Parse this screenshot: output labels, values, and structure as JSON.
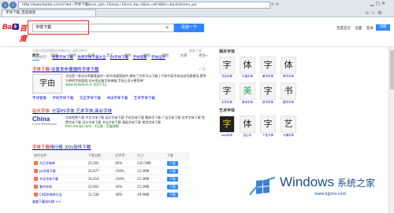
{
  "browser": {
    "address": "http://www.baidu.com/s?wd=字体下载&rsv_spt=1&issp=1&rsv_bp=0&ie=utf-8&tn=baiduhome_pg",
    "tab_active": "字体下载_百度搜索",
    "tab_inactive": "",
    "back_icon": "back-arrow-icon",
    "forward_icon": "forward-arrow-icon"
  },
  "header": {
    "logo_bai": "Bai",
    "logo_du": "百度",
    "query": "字体下载",
    "search_button": "百度一下",
    "links": [
      "百度首页",
      "设置",
      "登录"
    ],
    "settings_label": "注册"
  },
  "nav_tabs": [
    "网页",
    "新闻",
    "贴吧",
    "知道",
    "音乐",
    "图片",
    "视频",
    "地图",
    "文库",
    "更多»"
  ],
  "active_tab": "网页",
  "result_stats": "百度为您找到相关结果约12,300,000个",
  "tools_link": "搜索工具",
  "related": {
    "label": "为您推荐:",
    "links": [
      "免费字体下载",
      "免费字体下载大全",
      "ps字体下载",
      "字体管家",
      "字体设计"
    ]
  },
  "ad": {
    "title_em": "字体下载",
    "title_rest": "-往复发布便捷的字体下载",
    "image_text": "字由",
    "desc": "字由是一款设计师最喜爱的一款字体管理软件,拥有了它你可以下载上千款中英字体自由切换使用,提供方便的字体管理,设计师必备字体神器,字由让设计更简单!",
    "url": "www.hellofont.cn  2017-11",
    "ad_tag": "广告"
  },
  "sub_links": [
    "字体管家",
    "手机字体下载",
    "方正字体下载",
    "书法字体下载",
    "艺术字体下载"
  ],
  "result2": {
    "title_em": "站长字体",
    "title_rest": "_分享PS字体,艺术字体,商业字体",
    "logo_t1": "China",
    "logo_t2": "China Webmaster",
    "desc": "字体免费下载 中文字体下载 英文字体下载 手机字体下载 繁体字下载 广告字体下载 艺术字体下载 免费字体下载 设计字体下载 书法字体下载 漫画字体下载 常用字体下载",
    "url": "font.chinaz.com/ - 1日前 - 百度快照"
  },
  "result3": {
    "title_em": "字体下载",
    "title_rest": "排行榜_ZOL软件下载",
    "columns": [
      "软件名称",
      "下载次数",
      "好评率",
      "大小",
      "下载"
    ],
    "rows": [
      {
        "name": "方正字体库",
        "count": "25,265",
        "rate": "85%",
        "size": "230.5MB",
        "btn": "下载"
      },
      {
        "name": "ps字体下载",
        "count": "20,677",
        "rate": "100%",
        "size": "22.4MB",
        "btn": "下载"
      },
      {
        "name": "书法字体下载",
        "count": "16,414",
        "rate": "100%",
        "size": "22.4MB",
        "btn": "下载"
      },
      {
        "name": "篆书字体",
        "count": "12,903",
        "rate": "40%",
        "size": "25.2MB",
        "btn": "下载"
      },
      {
        "name": "CAD字体库大全",
        "count": "11,108",
        "rate": "48%",
        "size": "49.9MB",
        "btn": "下载"
      }
    ],
    "more": "查看下载排行榜 >>"
  },
  "right_panel": {
    "title1": "相关字体",
    "thumbs1": [
      {
        "img": "字",
        "cap": "书法字体"
      },
      {
        "img": "体",
        "cap": "行楷字体"
      },
      {
        "img": "字",
        "cap": "隶书字体"
      },
      {
        "img": "体",
        "cap": "草书字体"
      },
      {
        "img": "字",
        "cap": "手写字体"
      },
      {
        "img": "美",
        "cap": "美术字体"
      },
      {
        "img": "字",
        "cap": "篆书字体"
      },
      {
        "img": "书",
        "cap": "楷书字体"
      }
    ],
    "title2": "艺术字体",
    "thumbs2": [
      {
        "img": "字",
        "cap": "pop字体"
      },
      {
        "img": "体",
        "cap": "空心字"
      },
      {
        "img": "字",
        "cap": "个性字体"
      },
      {
        "img": "艺",
        "cap": "卡通字体"
      }
    ]
  },
  "watermark": {
    "windows": "Windows",
    "cn": "系统之家",
    "url": "www.bjjmlv.com"
  }
}
